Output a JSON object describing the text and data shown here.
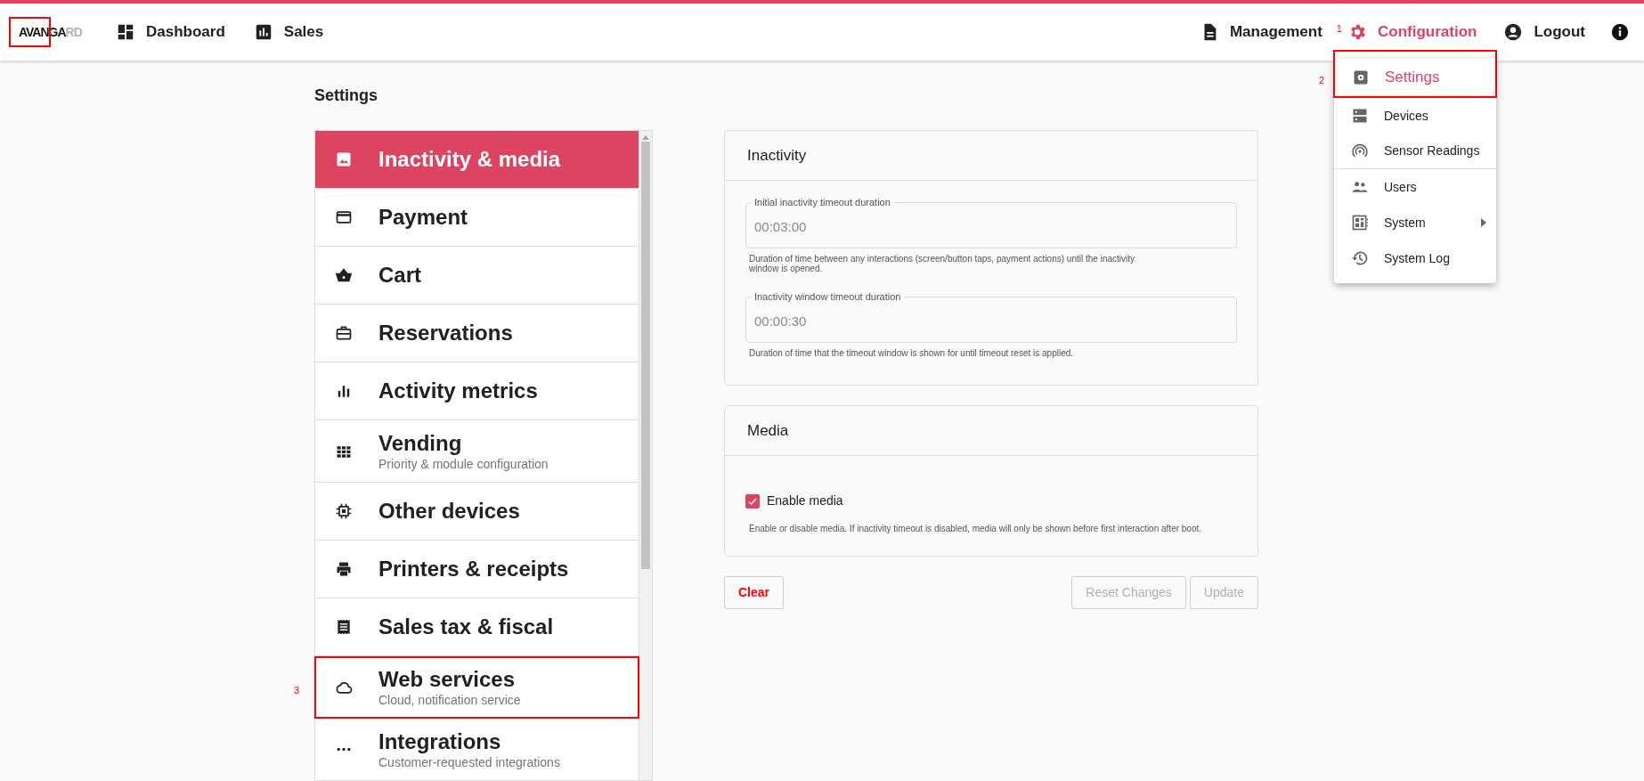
{
  "header": {
    "logo": {
      "dark": "AVANGA",
      "light": "RD",
      "highlighted": true
    },
    "nav_left": [
      {
        "label": "Dashboard"
      },
      {
        "label": "Sales"
      }
    ],
    "nav_right": [
      {
        "label": "Management",
        "selected": false
      },
      {
        "label": "Configuration",
        "selected": true,
        "annotation": "1"
      },
      {
        "label": "Logout",
        "selected": false
      }
    ]
  },
  "page_title": "Settings",
  "sidebar": {
    "items": [
      {
        "label": "Inactivity & media",
        "selected": true,
        "highlighted": false
      },
      {
        "label": "Payment",
        "selected": false,
        "highlighted": false
      },
      {
        "label": "Cart",
        "selected": false,
        "highlighted": false
      },
      {
        "label": "Reservations",
        "selected": false,
        "highlighted": false
      },
      {
        "label": "Activity metrics",
        "selected": false,
        "highlighted": false
      },
      {
        "label": "Vending",
        "subtitle": "Priority & module configuration",
        "selected": false,
        "highlighted": false
      },
      {
        "label": "Other devices",
        "selected": false,
        "highlighted": false
      },
      {
        "label": "Printers & receipts",
        "selected": false,
        "highlighted": false
      },
      {
        "label": "Sales tax & fiscal",
        "selected": false,
        "highlighted": false
      },
      {
        "label": "Web services",
        "subtitle": "Cloud, notification service",
        "selected": false,
        "highlighted": true,
        "annotation": "3"
      },
      {
        "label": "Integrations",
        "subtitle": "Customer-requested integrations",
        "selected": false,
        "highlighted": false
      }
    ]
  },
  "cards": [
    {
      "title": "Inactivity",
      "controls": [
        {
          "kind": "field",
          "label": "Initial inactivity timeout duration",
          "value": "00:03:00",
          "help": "Duration of time between any interactions (screen/button taps, payment actions) until the inactivity window is opened."
        },
        {
          "kind": "field",
          "label": "Inactivity window timeout duration",
          "value": "00:00:30",
          "help": "Duration of time that the timeout window is shown for until timeout reset is applied."
        }
      ]
    },
    {
      "title": "Media",
      "controls": [
        {
          "kind": "checkbox",
          "label": "Enable media",
          "checked": true,
          "help": "Enable or disable media. If inactivity timeout is disabled, media will only be shown before first interaction after boot."
        }
      ]
    }
  ],
  "actions": [
    {
      "label": "Clear",
      "kind": "danger",
      "disabled": false
    },
    {
      "label": "Reset Changes",
      "kind": "normal",
      "disabled": true
    },
    {
      "label": "Update",
      "kind": "normal",
      "disabled": true
    }
  ],
  "menu": {
    "items": [
      {
        "label": "Settings",
        "selected": true,
        "divider_after": true,
        "submenu": false,
        "highlighted": true,
        "annotation": "2"
      },
      {
        "label": "Devices",
        "selected": false,
        "divider_after": false,
        "submenu": false,
        "highlighted": false
      },
      {
        "label": "Sensor Readings",
        "selected": false,
        "divider_after": true,
        "submenu": false,
        "highlighted": false
      },
      {
        "label": "Users",
        "selected": false,
        "divider_after": false,
        "submenu": false,
        "highlighted": false
      },
      {
        "label": "System",
        "selected": false,
        "divider_after": false,
        "submenu": true,
        "highlighted": false
      },
      {
        "label": "System Log",
        "selected": false,
        "divider_after": false,
        "submenu": false,
        "highlighted": false
      }
    ]
  }
}
